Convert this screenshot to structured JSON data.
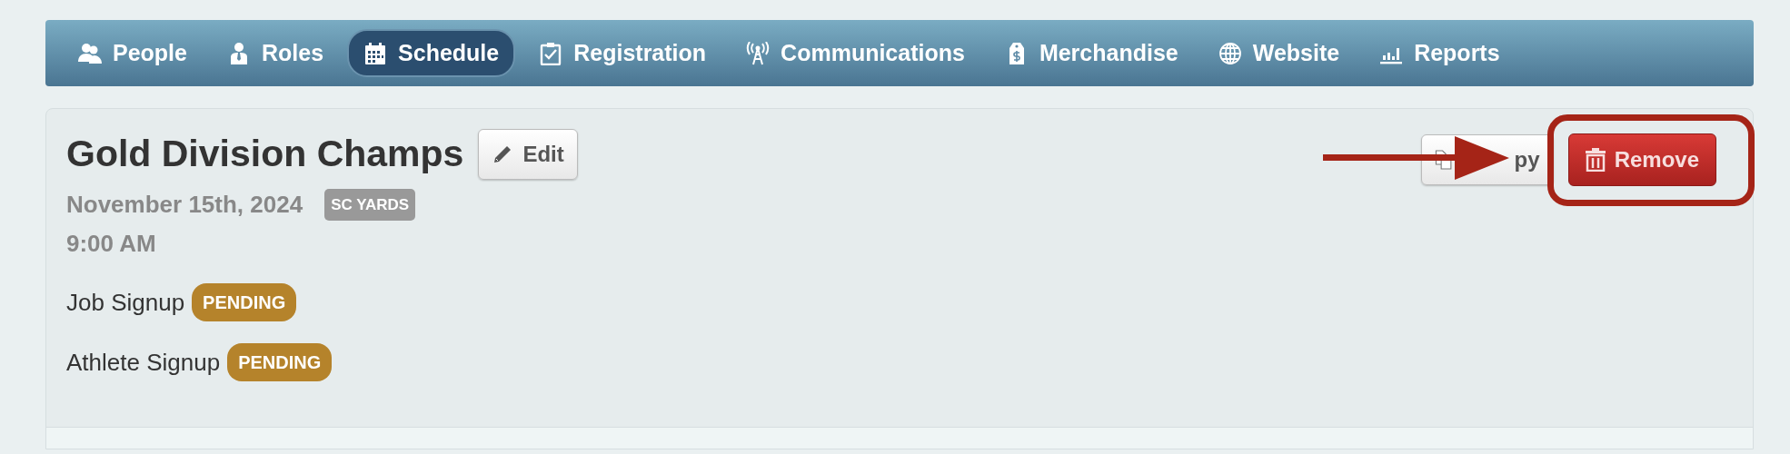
{
  "nav": [
    {
      "label": "People",
      "selected": false
    },
    {
      "label": "Roles",
      "selected": false
    },
    {
      "label": "Schedule",
      "selected": true
    },
    {
      "label": "Registration",
      "selected": false
    },
    {
      "label": "Communications",
      "selected": false
    },
    {
      "label": "Merchandise",
      "selected": false
    },
    {
      "label": "Website",
      "selected": false
    },
    {
      "label": "Reports",
      "selected": false
    }
  ],
  "event": {
    "title": "Gold Division Champs",
    "edit_button": "Edit",
    "date": "November 15th, 2024",
    "course_badge": "SC YARDS",
    "time": "9:00 AM",
    "signups": [
      {
        "label": "Job Signup",
        "status": "PENDING"
      },
      {
        "label": "Athlete Signup",
        "status": "PENDING"
      }
    ],
    "copy_button": "py",
    "remove_button": "Remove"
  },
  "annotations": [
    {
      "kind": "arrow"
    },
    {
      "kind": "highlight"
    }
  ]
}
